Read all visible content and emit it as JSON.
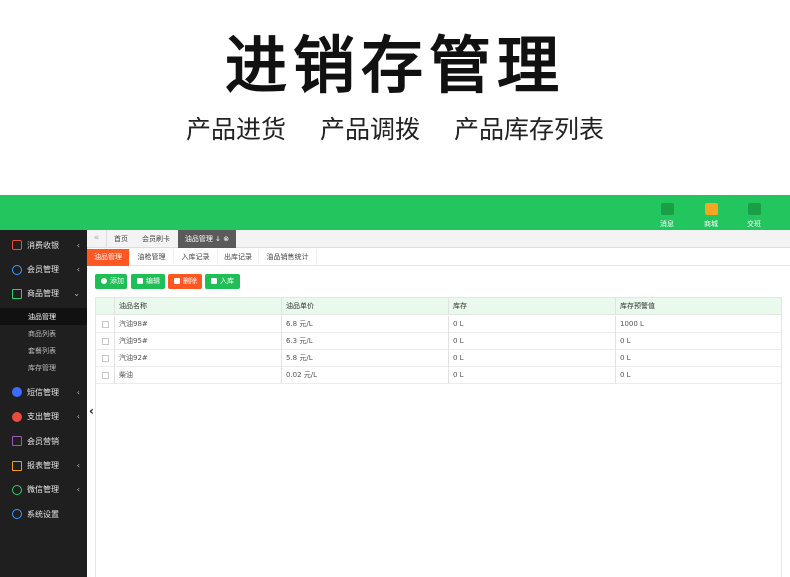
{
  "hero": {
    "title": "进销存管理",
    "subtitle": [
      "产品进货",
      "产品调拨",
      "产品库存列表"
    ]
  },
  "colors": {
    "brand_green": "#22c55e",
    "accent_orange": "#ff5722",
    "sidebar_bg": "#1f1f1f"
  },
  "topbar": {
    "actions": [
      {
        "label": "消息",
        "icon": "leaf-icon"
      },
      {
        "label": "商城",
        "icon": "shop-icon"
      },
      {
        "label": "交班",
        "icon": "swap-icon"
      }
    ]
  },
  "sidebar": {
    "items": [
      {
        "label": "消费收银",
        "icon": "cashier-icon",
        "chevron": "‹"
      },
      {
        "label": "会员管理",
        "icon": "members-icon",
        "chevron": "‹"
      },
      {
        "label": "商品管理",
        "icon": "goods-icon",
        "chevron": "‹"
      },
      {
        "label": "短信管理",
        "icon": "sms-icon",
        "chevron": "‹"
      },
      {
        "label": "支出管理",
        "icon": "expense-icon",
        "chevron": "‹"
      },
      {
        "label": "会员营销",
        "icon": "gift-icon",
        "chevron": ""
      },
      {
        "label": "报表管理",
        "icon": "report-icon",
        "chevron": "‹"
      },
      {
        "label": "微信管理",
        "icon": "wechat-icon",
        "chevron": "‹"
      },
      {
        "label": "系统设置",
        "icon": "settings-icon",
        "chevron": ""
      }
    ],
    "goods_submenu": [
      "油品管理",
      "商品列表",
      "套餐列表",
      "库存管理"
    ]
  },
  "tabs": {
    "back": "«",
    "items": [
      "首页",
      "会员刷卡",
      "油品管理"
    ],
    "active_markers": "↓ ⊗"
  },
  "subtabs": [
    "油品管理",
    "油枪管理",
    "入库记录",
    "出库记录",
    "油品销售统计"
  ],
  "toolbar": {
    "add": "添加",
    "edit": "编辑",
    "delete": "删除",
    "stock_in": "入库"
  },
  "table": {
    "headers": [
      "油品名称",
      "油品单价",
      "库存",
      "库存预警值"
    ],
    "rows": [
      [
        "汽油98#",
        "6.8 元/L",
        "0 L",
        "1000 L"
      ],
      [
        "汽油95#",
        "6.3 元/L",
        "0 L",
        "0 L"
      ],
      [
        "汽油92#",
        "5.8 元/L",
        "0 L",
        "0 L"
      ],
      [
        "柴油",
        "0.02 元/L",
        "0 L",
        "0 L"
      ]
    ]
  },
  "collapse": "‹"
}
